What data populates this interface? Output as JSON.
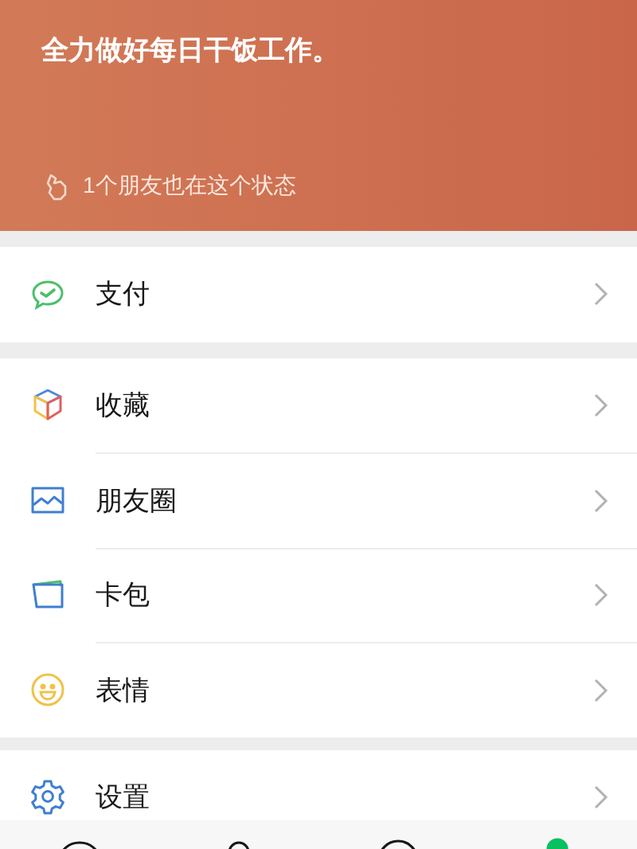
{
  "status_header": {
    "text": "全力做好每日干饭工作。",
    "friends_note": "1个朋友也在这个状态"
  },
  "groups": [
    {
      "items": [
        {
          "kind": "pay",
          "label": "支付"
        }
      ]
    },
    {
      "items": [
        {
          "kind": "favorites",
          "label": "收藏"
        },
        {
          "kind": "moments",
          "label": "朋友圈"
        },
        {
          "kind": "cards",
          "label": "卡包"
        },
        {
          "kind": "stickers",
          "label": "表情"
        }
      ]
    },
    {
      "items": [
        {
          "kind": "settings",
          "label": "设置"
        }
      ]
    }
  ],
  "tab_bar": [
    {
      "kind": "chats",
      "selected": false
    },
    {
      "kind": "contacts",
      "selected": false
    },
    {
      "kind": "discover",
      "selected": false
    },
    {
      "kind": "me",
      "selected": true
    }
  ]
}
